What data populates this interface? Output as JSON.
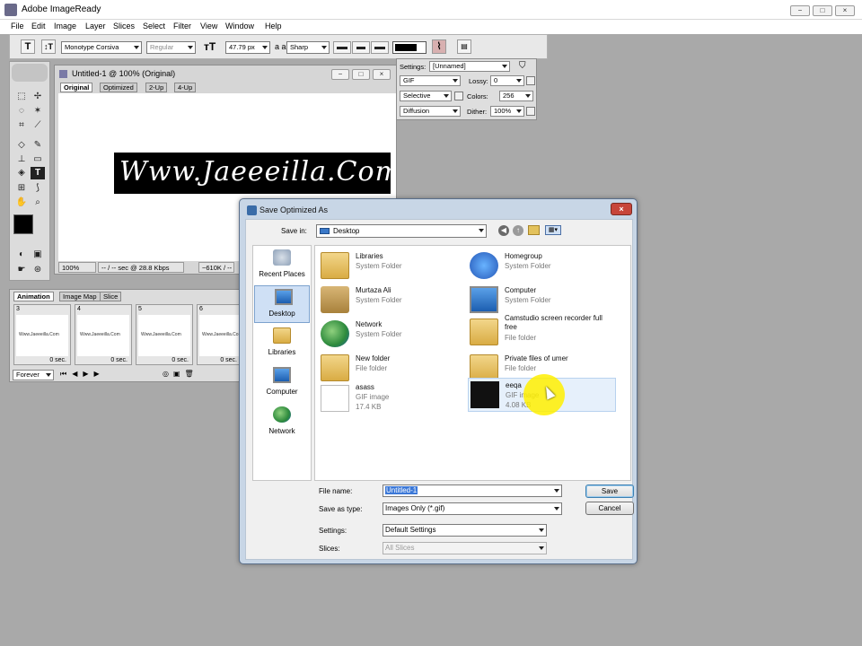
{
  "app": {
    "title": "Adobe ImageReady",
    "window_buttons": [
      "−",
      "□",
      "×"
    ]
  },
  "menu": [
    "File",
    "Edit",
    "Image",
    "Layer",
    "Slices",
    "Select",
    "Filter",
    "View",
    "Window",
    "Help"
  ],
  "options_bar": {
    "font_family": "Monotype Corsiva",
    "font_style": "Regular",
    "font_size": "47.79 px",
    "aa_label": "a a",
    "anti_alias": "Sharp"
  },
  "document": {
    "title": "Untitled-1 @ 100% (Original)",
    "tabs": [
      "Original",
      "Optimized",
      "2-Up",
      "4-Up"
    ],
    "banner_text": "Www.Jaeeeilla.Com",
    "zoom": "100%",
    "time": "-- / -- sec @ 28.8 Kbps",
    "size": "~610K / --"
  },
  "optimize": {
    "settings_label": "Settings:",
    "settings_value": "[Unnamed]",
    "format": "GIF",
    "lossy_label": "Lossy:",
    "lossy": "0",
    "palette": "Selective",
    "colors_label": "Colors:",
    "colors": "256",
    "dither_algo": "Diffusion",
    "dither_label": "Dither:",
    "dither": "100%"
  },
  "animation": {
    "tabs": [
      "Animation",
      "Image Map",
      "Slice"
    ],
    "frames": [
      {
        "num": "3",
        "delay": "0 sec."
      },
      {
        "num": "4",
        "delay": "0 sec."
      },
      {
        "num": "5",
        "delay": "0 sec."
      },
      {
        "num": "6",
        "delay": "0 sec."
      }
    ],
    "thumb_text": "Www.Jaeeeilla.Com",
    "loop": "Forever"
  },
  "dialog": {
    "title": "Save Optimized As",
    "close": "×",
    "save_in_label": "Save in:",
    "save_in_value": "Desktop",
    "places": [
      "Recent Places",
      "Desktop",
      "Libraries",
      "Computer",
      "Network"
    ],
    "files": [
      {
        "name": "Libraries",
        "type": "System Folder",
        "size": ""
      },
      {
        "name": "Homegroup",
        "type": "System Folder",
        "size": ""
      },
      {
        "name": "Murtaza Ali",
        "type": "System Folder",
        "size": ""
      },
      {
        "name": "Computer",
        "type": "System Folder",
        "size": ""
      },
      {
        "name": "Network",
        "type": "System Folder",
        "size": ""
      },
      {
        "name": "Camstudio screen recorder full free",
        "type": "File folder",
        "size": ""
      },
      {
        "name": "New folder",
        "type": "File folder",
        "size": ""
      },
      {
        "name": "Private files of umer",
        "type": "File folder",
        "size": ""
      },
      {
        "name": "asass",
        "type": "GIF image",
        "size": "17.4 KB"
      },
      {
        "name": "eeqa",
        "type": "GIF image",
        "size": "4.08 KB"
      }
    ],
    "file_name_label": "File name:",
    "file_name": "Untitled-1",
    "save_type_label": "Save as type:",
    "save_type": "Images Only (*.gif)",
    "settings_label": "Settings:",
    "settings": "Default Settings",
    "slices_label": "Slices:",
    "slices": "All Slices",
    "save_btn": "Save",
    "cancel_btn": "Cancel"
  },
  "colors": {
    "accent": "#3b78d8",
    "close_red": "#c7453a",
    "highlight": "#ffef00"
  }
}
